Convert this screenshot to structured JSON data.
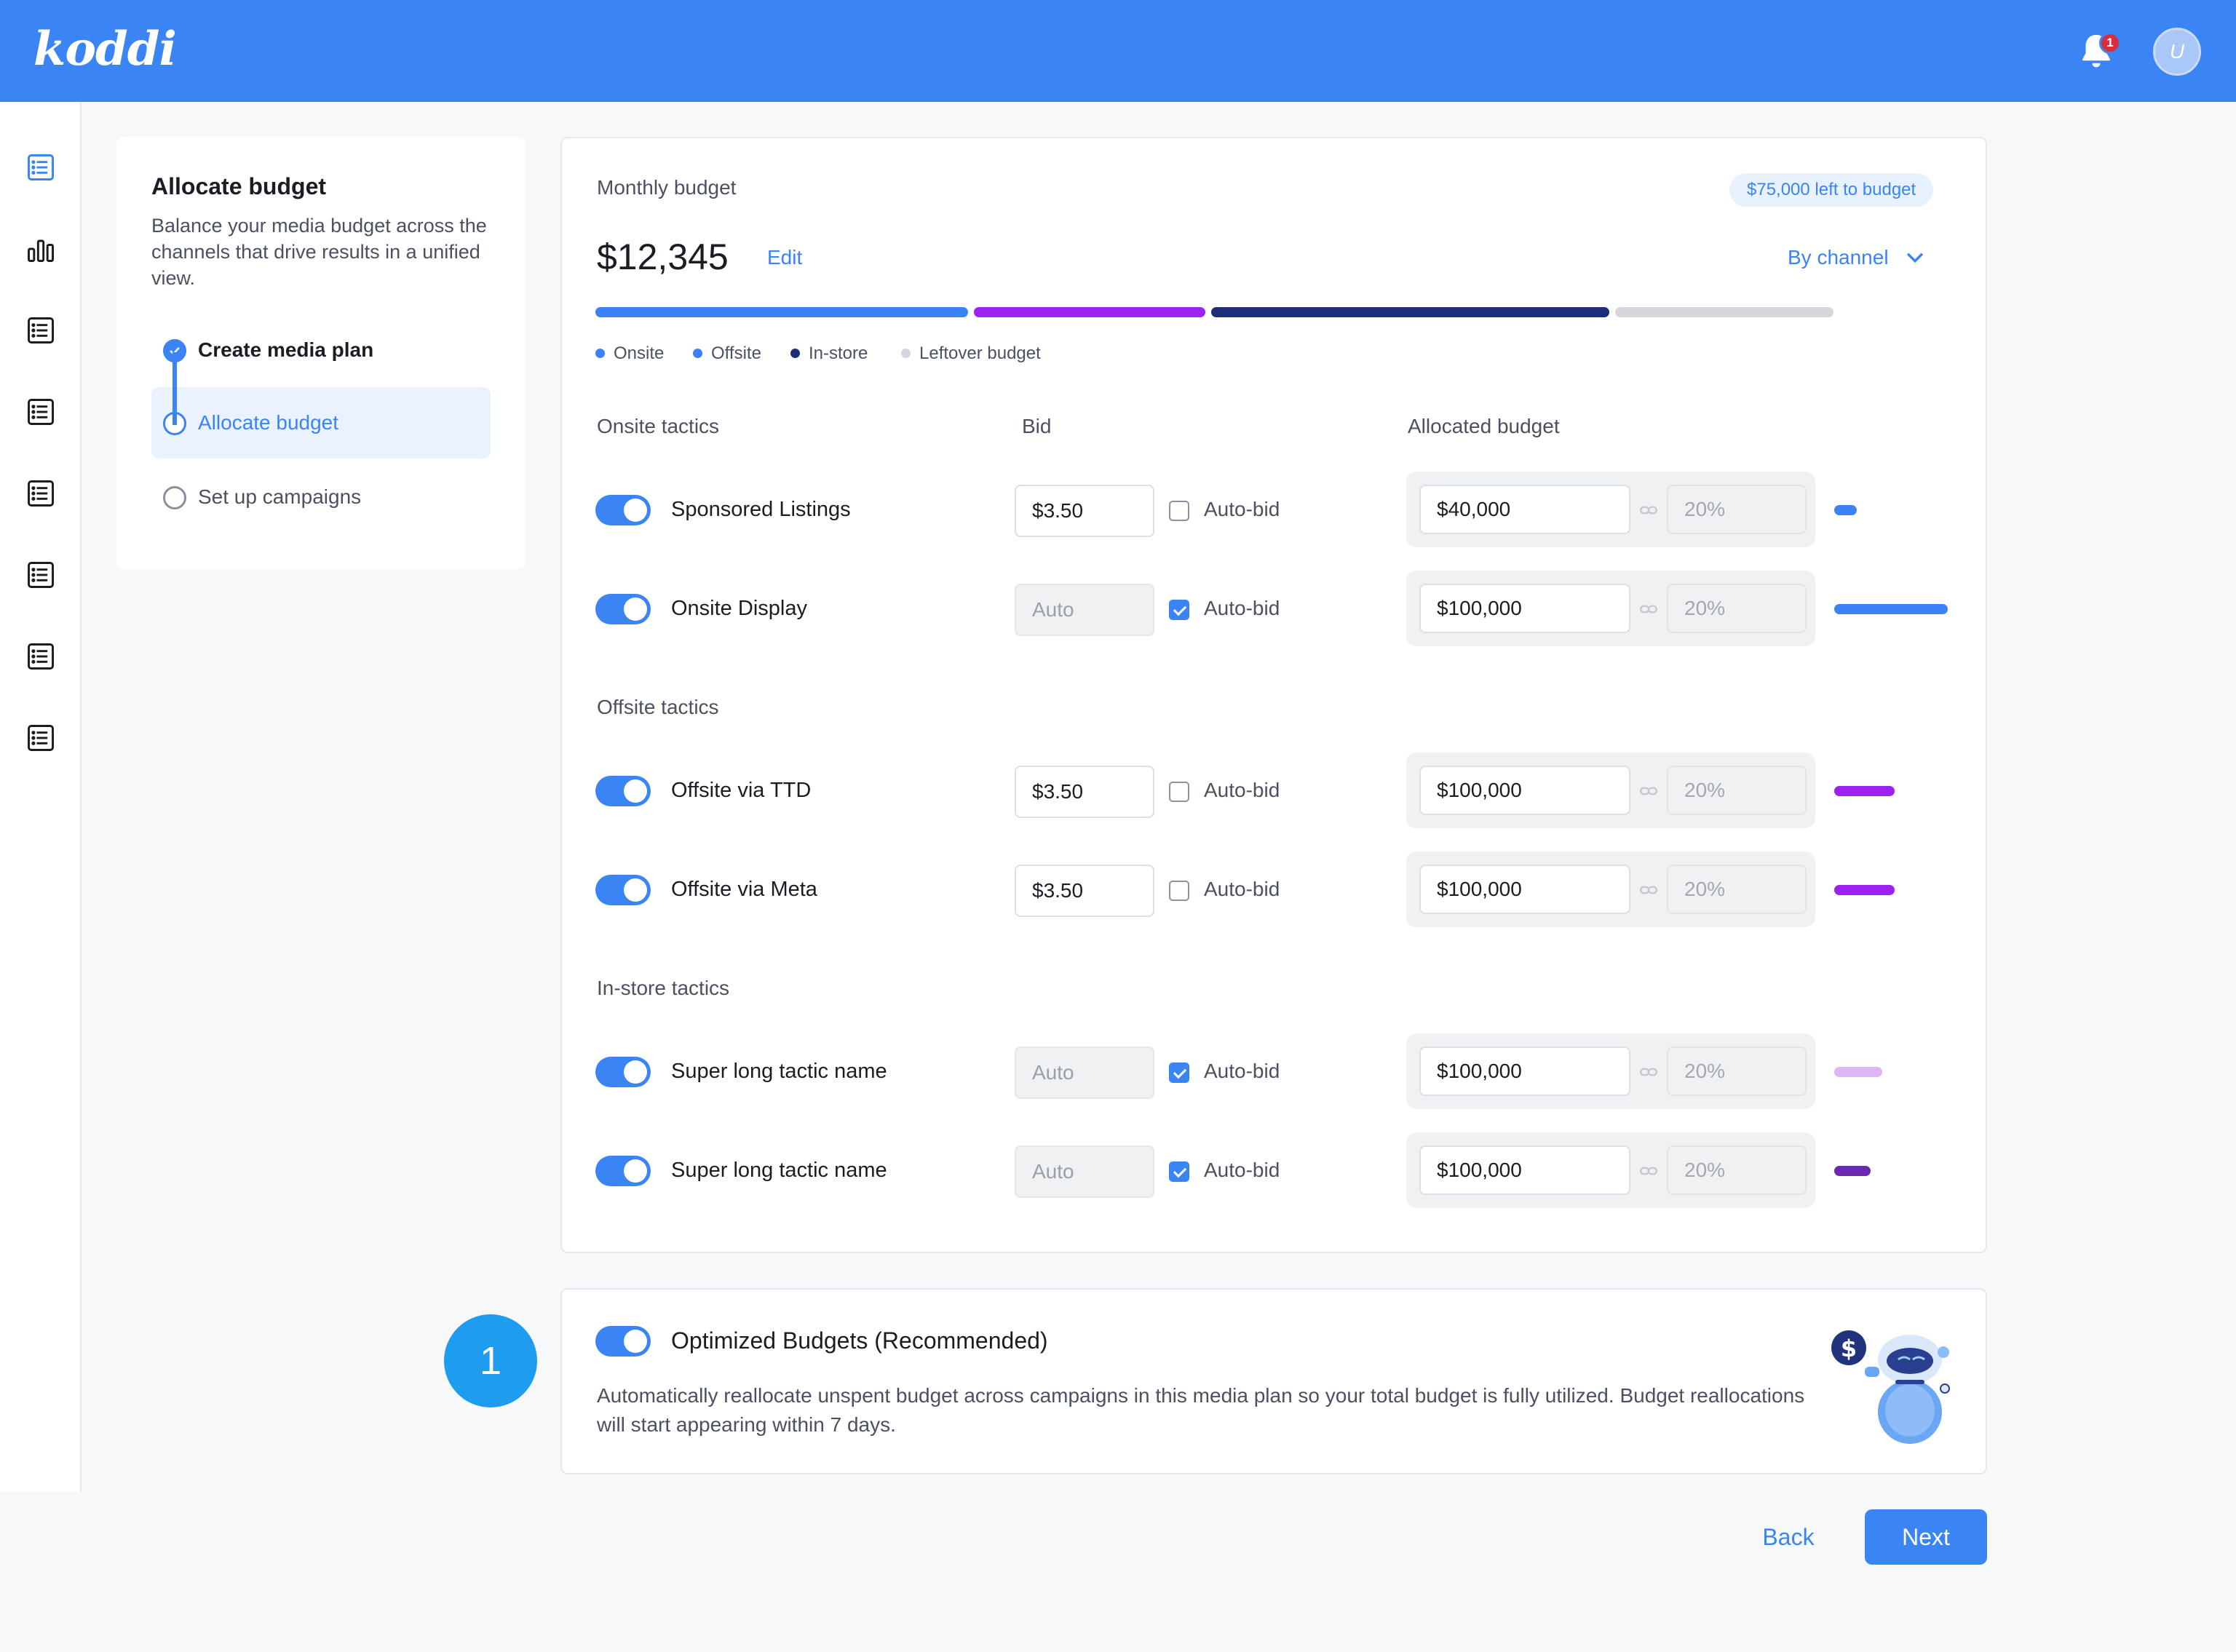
{
  "header": {
    "logo": "koddi",
    "notifications_count": "1",
    "avatar_initial": "U"
  },
  "colors": {
    "brand": "#3a84f4",
    "onsite": "#3b82f6",
    "offsite": "#9b22f0",
    "instore": "#1c2e7a",
    "leftover": "#d4d6db",
    "instore_light": "#dcb6f5",
    "instore_dark": "#6a2ab0"
  },
  "rail": {
    "icons": [
      "list-icon",
      "bar-chart-icon",
      "list-icon",
      "list-icon",
      "list-icon",
      "list-icon",
      "list-icon",
      "list-icon"
    ]
  },
  "steps": {
    "title": "Allocate budget",
    "description": "Balance your media budget across the channels that drive results in a unified view.",
    "items": [
      {
        "label": "Create media plan",
        "state": "done"
      },
      {
        "label": "Allocate budget",
        "state": "current"
      },
      {
        "label": "Set up campaigns",
        "state": "todo"
      }
    ]
  },
  "budget": {
    "label": "Monthly budget",
    "left_pill": "$75,000 left to budget",
    "amount": "$12,345",
    "edit": "Edit",
    "view_select": "By channel",
    "segments": [
      {
        "name": "Onsite",
        "fraction": 0.29
      },
      {
        "name": "Offsite",
        "fraction": 0.18
      },
      {
        "name": "In-store",
        "fraction": 0.31
      },
      {
        "name": "Leftover budget",
        "fraction": 0.17
      }
    ],
    "legend": [
      "Onsite",
      "Offsite",
      "In-store",
      "Leftover budget"
    ]
  },
  "columns": {
    "tactics": "Onsite tactics",
    "bid": "Bid",
    "allocated": "Allocated budget"
  },
  "sections": [
    {
      "title": "Onsite tactics",
      "rows": [
        {
          "name": "Sponsored Listings",
          "bid": "$3.50",
          "auto": false,
          "autobid_label": "Auto-bid",
          "allocated": "$40,000",
          "percent": "20%",
          "bar_fraction": 0.2
        },
        {
          "name": "Onsite Display",
          "bid": "Auto",
          "auto": true,
          "autobid_label": "Auto-bid",
          "allocated": "$100,000",
          "percent": "20%",
          "bar_fraction": 1.0
        }
      ]
    },
    {
      "title": "Offsite tactics",
      "rows": [
        {
          "name": "Offsite via TTD",
          "bid": "$3.50",
          "auto": false,
          "autobid_label": "Auto-bid",
          "allocated": "$100,000",
          "percent": "20%",
          "bar_fraction": 0.53
        },
        {
          "name": "Offsite via Meta",
          "bid": "$3.50",
          "auto": false,
          "autobid_label": "Auto-bid",
          "allocated": "$100,000",
          "percent": "20%",
          "bar_fraction": 0.53
        }
      ]
    },
    {
      "title": "In-store tactics",
      "rows": [
        {
          "name": "Super long tactic name",
          "bid": "Auto",
          "auto": true,
          "autobid_label": "Auto-bid",
          "allocated": "$100,000",
          "percent": "20%",
          "bar_fraction": 0.42
        },
        {
          "name": "Super long tactic name",
          "bid": "Auto",
          "auto": true,
          "autobid_label": "Auto-bid",
          "allocated": "$100,000",
          "percent": "20%",
          "bar_fraction": 0.32
        }
      ]
    }
  ],
  "optimized": {
    "title": "Optimized Budgets (Recommended)",
    "description": "Automatically reallocate unspent budget across campaigns in this media plan so your total budget is fully utilized. Budget reallocations will start appearing within 7 days.",
    "enabled": true
  },
  "step_number": "1",
  "actions": {
    "back": "Back",
    "next": "Next"
  }
}
